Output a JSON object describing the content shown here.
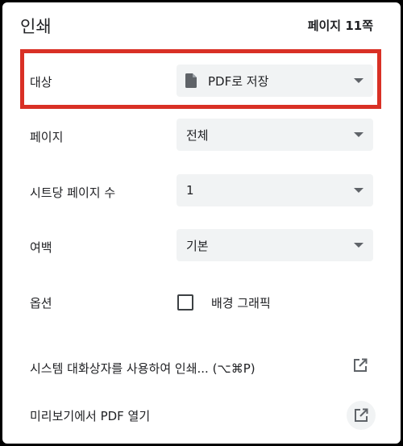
{
  "header": {
    "title": "인쇄",
    "page_count": "페이지 11쪽"
  },
  "destination": {
    "label": "대상",
    "value": "PDF로 저장",
    "icon": "file-icon"
  },
  "pages": {
    "label": "페이지",
    "value": "전체"
  },
  "pages_per_sheet": {
    "label": "시트당 페이지 수",
    "value": "1"
  },
  "margins": {
    "label": "여백",
    "value": "기본"
  },
  "options": {
    "label": "옵션",
    "checkbox_label": "배경 그래픽",
    "checked": false
  },
  "links": {
    "system_dialog": "시스템 대화상자를 사용하여 인쇄... (⌥⌘P)",
    "open_preview": "미리보기에서 PDF 열기"
  },
  "colors": {
    "highlight": "#d93025",
    "select_bg": "#f1f3f4"
  }
}
